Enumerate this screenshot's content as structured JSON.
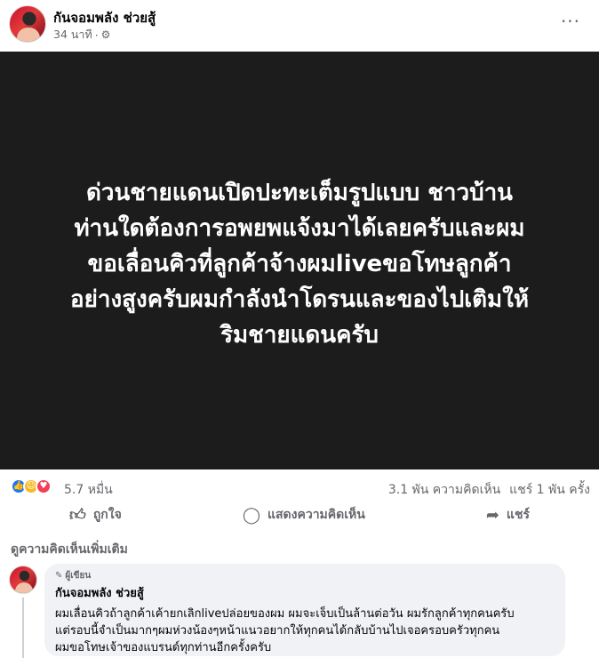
{
  "post": {
    "author": "กันจอมพลัง ช่วยสู้",
    "time": "34 นาที",
    "separator": "·",
    "privacy_icon": "gear-icon",
    "more_icon": "···",
    "text": "ด่วนชายแดนเปิดปะทะเต็มรูปแบบ ชาวบ้านท่านใดต้องการอพยพแจ้งมาได้เลยครับและผมขอเลื่อนคิวที่ลูกค้าจ้างผมliveขอโทษลูกค้าอย่างสูงครับผมกำลังนำโดรนและของไปเติมให้ริมชายแดนครับ",
    "text_lines": [
      "ด่วนชายแดนเปิดปะทะเต็มรูปแบบ ชาวบ้าน",
      "ท่านใดต้องการอพยพแจ้งมาได้เลยครับและผม",
      "ขอเลื่อนคิวที่ลูกค้าจ้างผมliveขอโทษลูกค้า",
      "อย่างสูงครับผมกำลังนำโดรนและของไปเติมให้",
      "ริมชายแดนครับ"
    ],
    "background_color": "#1c1c1c"
  },
  "stats": {
    "reaction_icons": [
      "like",
      "care",
      "love"
    ],
    "reaction_count": "5.7 หมื่น",
    "comments": "3.1 พัน ความคิดเห็น",
    "shares": "แชร์ 1 พัน ครั้ง"
  },
  "actions": {
    "like": "ถูกใจ",
    "comment": "แสดงความคิดเห็น",
    "share": "แชร์"
  },
  "comments_section": {
    "more_label": "ดูความคิดเห็นเพิ่มเติม",
    "comment": {
      "badge": "ผู้เขียน",
      "author": "กันจอมพลัง ช่วยสู้",
      "lines": [
        "ผมเลื่อนคิวถ้าลูกค้าเค้ายกเลิกliveปล่อยของผม ผมจะเจ็บเป็นล้านต่อวัน ผมรักลูกค้าทุกคนครับ",
        "แต่รอบนี้จำเป็นมากๆผมห่วงน้องๆหน้าแนวอยากให้ทุกคนได้กลับบ้านไปเจอครอบครัวทุกคน",
        "ผมขอโทษเจ้าของแบรนด์ทุกท่านอีกครั้งครับ"
      ]
    }
  },
  "colors": {
    "like_blue": "#1877f2",
    "care_yellow": "#f7b928",
    "love_red": "#f33e58",
    "muted_text": "#65676b",
    "comment_bg": "#f0f2f5"
  }
}
